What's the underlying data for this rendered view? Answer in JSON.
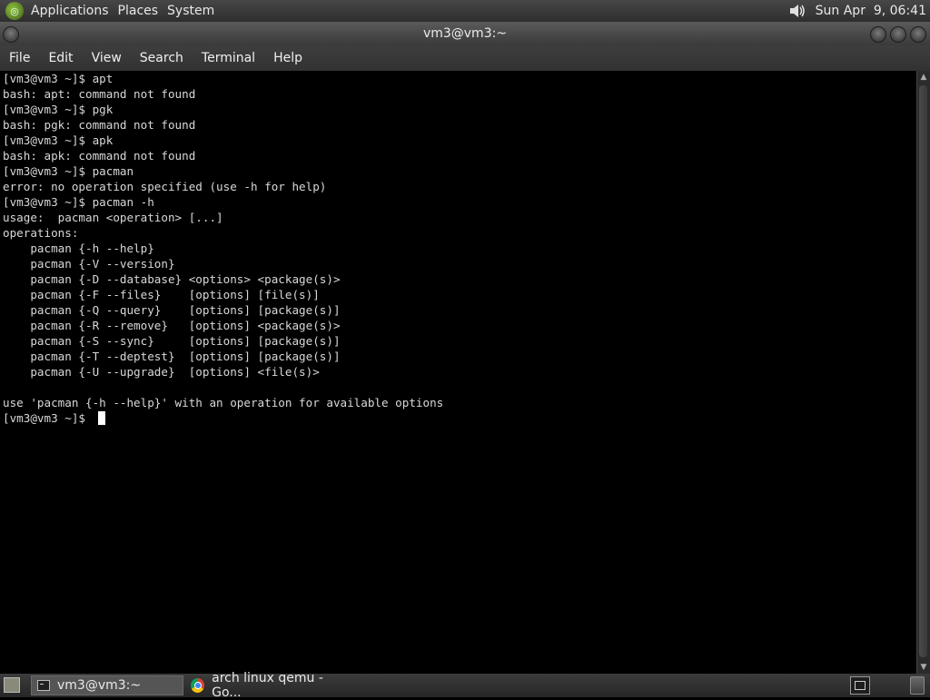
{
  "top_panel": {
    "menus": [
      "Applications",
      "Places",
      "System"
    ],
    "clock": "Sun Apr  9, 06:41",
    "volume_icon": "speaker-icon"
  },
  "window": {
    "title": "vm3@vm3:~"
  },
  "menubar": {
    "items": [
      "File",
      "Edit",
      "View",
      "Search",
      "Terminal",
      "Help"
    ]
  },
  "terminal": {
    "lines": [
      "[vm3@vm3 ~]$ apt",
      "bash: apt: command not found",
      "[vm3@vm3 ~]$ pgk",
      "bash: pgk: command not found",
      "[vm3@vm3 ~]$ apk",
      "bash: apk: command not found",
      "[vm3@vm3 ~]$ pacman",
      "error: no operation specified (use -h for help)",
      "[vm3@vm3 ~]$ pacman -h",
      "usage:  pacman <operation> [...]",
      "operations:",
      "    pacman {-h --help}",
      "    pacman {-V --version}",
      "    pacman {-D --database} <options> <package(s)>",
      "    pacman {-F --files}    [options] [file(s)]",
      "    pacman {-Q --query}    [options] [package(s)]",
      "    pacman {-R --remove}   [options] <package(s)>",
      "    pacman {-S --sync}     [options] [package(s)]",
      "    pacman {-T --deptest}  [options] [package(s)]",
      "    pacman {-U --upgrade}  [options] <file(s)>",
      "",
      "use 'pacman {-h --help}' with an operation for available options"
    ],
    "prompt": "[vm3@vm3 ~]$ "
  },
  "taskbar": {
    "tasks": [
      {
        "label": "vm3@vm3:~",
        "icon": "terminal-icon"
      },
      {
        "label": "arch linux qemu - Go...",
        "icon": "chrome-icon"
      }
    ]
  }
}
